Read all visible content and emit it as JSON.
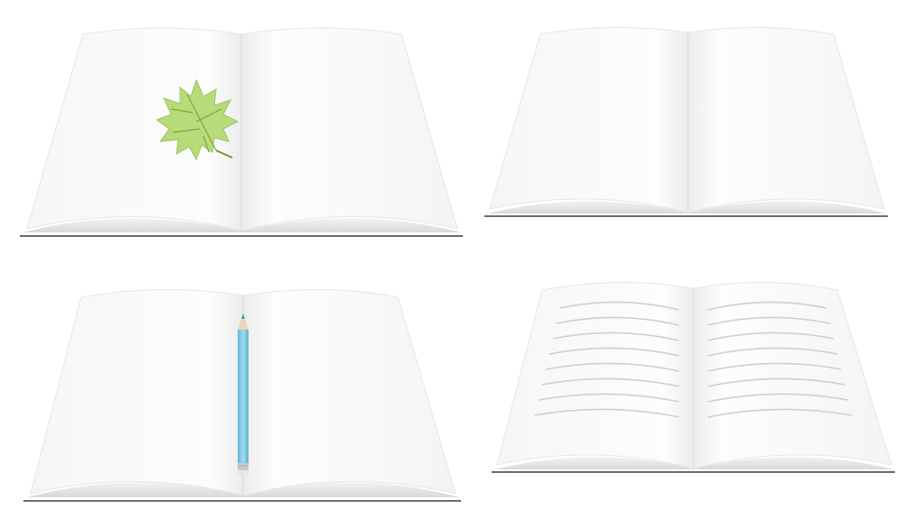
{
  "scene": {
    "description_hidden": "",
    "background_color": "#ffffff",
    "books": [
      {
        "name": "book-with-leaf",
        "accessory": "maple-leaf"
      },
      {
        "name": "book-blank",
        "accessory": "none"
      },
      {
        "name": "book-with-pencil",
        "accessory": "pencil"
      },
      {
        "name": "book-lined",
        "accessory": "ruled-lines"
      }
    ],
    "colors": {
      "page": "#fbfbfb",
      "page_edge": "#e4e4e4",
      "spine_shadow": "#e9e9e9",
      "cover_line": "#6b6b6b",
      "leaf": "#b8db7a",
      "leaf_vein": "#7da33c",
      "pencil_body": "#7ccbe3",
      "pencil_tip": "#3a9fc0",
      "ruled_line": "#cfcfcf"
    },
    "icons": [
      "maple-leaf-icon",
      "pencil-icon"
    ]
  }
}
